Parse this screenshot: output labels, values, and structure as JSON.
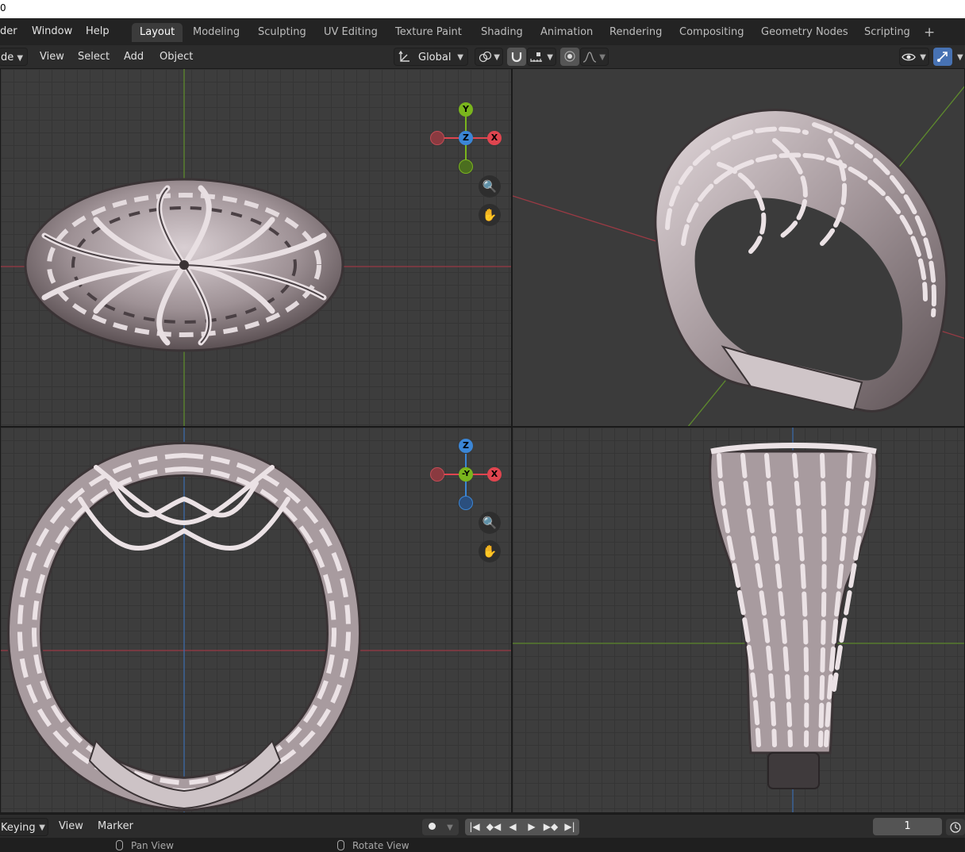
{
  "titlebar": {
    "fragment": "0"
  },
  "menubar": {
    "items": [
      "der",
      "Window",
      "Help"
    ]
  },
  "workspaces": {
    "tabs": [
      "Layout",
      "Modeling",
      "Sculpting",
      "UV Editing",
      "Texture Paint",
      "Shading",
      "Animation",
      "Rendering",
      "Compositing",
      "Geometry Nodes",
      "Scripting"
    ],
    "active": "Layout",
    "add_symbol": "+"
  },
  "viewport_header": {
    "mode_label": "de",
    "menus": [
      "View",
      "Select",
      "Add",
      "Object"
    ],
    "transform_orientation": "Global"
  },
  "gizmos": {
    "top": {
      "up": "Y",
      "center": "Z",
      "right": "X"
    },
    "front": {
      "up": "Z",
      "center": "-Y",
      "right": "X"
    }
  },
  "icons": {
    "zoom": "zoom-in-icon",
    "pan": "hand-pan-icon",
    "orientation": "transform-orientation-icon",
    "pivot": "pivot-point-icon",
    "snap": "snap-magnet-icon",
    "proportional": "proportional-edit-icon",
    "visibility": "object-visibility-icon",
    "gizmo_toggle": "gizmo-toggle-icon",
    "record": "record-icon",
    "playback": [
      "jump-start-icon",
      "prev-keyframe-icon",
      "play-reverse-icon",
      "play-icon",
      "next-keyframe-icon",
      "jump-end-icon"
    ],
    "timer": "timer-icon"
  },
  "colors": {
    "x_axis": "#e0454f",
    "y_axis": "#7ab51d",
    "z_axis": "#3b86d6",
    "active_blue": "#4772b3",
    "ring_metal": "#a79a9e"
  },
  "timeline": {
    "keying_label": "Keying",
    "menus": [
      "View",
      "Marker"
    ],
    "current_frame": "1"
  },
  "statusbar": {
    "items": [
      "Pan View",
      "Rotate View"
    ]
  }
}
